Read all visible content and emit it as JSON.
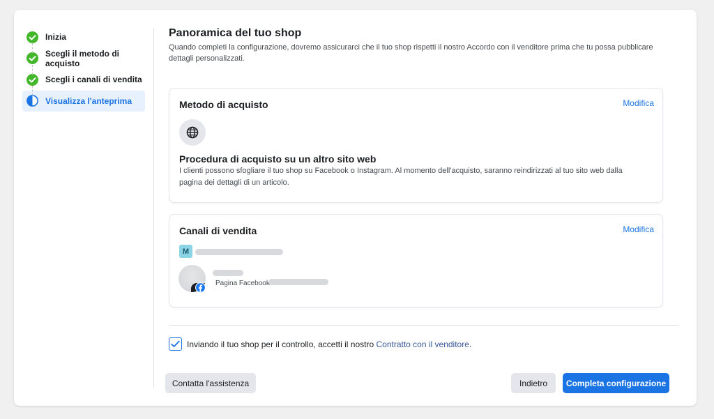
{
  "sidebar": {
    "steps": [
      {
        "label": "Inizia",
        "status": "completed"
      },
      {
        "label": "Scegli il metodo di acquisto",
        "status": "completed"
      },
      {
        "label": "Scegli i canali di vendita",
        "status": "completed"
      },
      {
        "label": "Visualizza l'anteprima",
        "status": "current"
      }
    ]
  },
  "main": {
    "title": "Panoramica del tuo shop",
    "subtitle": "Quando completi la configurazione, dovremo assicurarci che il tuo shop rispetti il nostro Accordo con il venditore prima che tu possa pubblicare dettagli personalizzati."
  },
  "purchase_method": {
    "title": "Metodo di acquisto",
    "edit_label": "Modifica",
    "icon": "globe-icon",
    "option_title": "Procedura di acquisto su un altro sito web",
    "option_desc": "I clienti possono sfogliare il tuo shop su Facebook o Instagram. Al momento dell'acquisto, saranno reindirizzati al tuo sito web dalla pagina dei dettagli di un articolo."
  },
  "sales_channels": {
    "title": "Canali di vendita",
    "edit_label": "Modifica",
    "commerce_badge": "M",
    "page_type_label": "Pagina Facebook·"
  },
  "agreement": {
    "checked": true,
    "text": "Inviando il tuo shop per il controllo, accetti il nostro ",
    "link_text": "Contratto con il venditore",
    "suffix": "."
  },
  "buttons": {
    "support": "Contatta l'assistenza",
    "back": "Indietro",
    "complete": "Completa configurazione"
  },
  "colors": {
    "accent": "#1b74e4",
    "success": "#42b72a",
    "page_bg": "#f0f0f0"
  }
}
